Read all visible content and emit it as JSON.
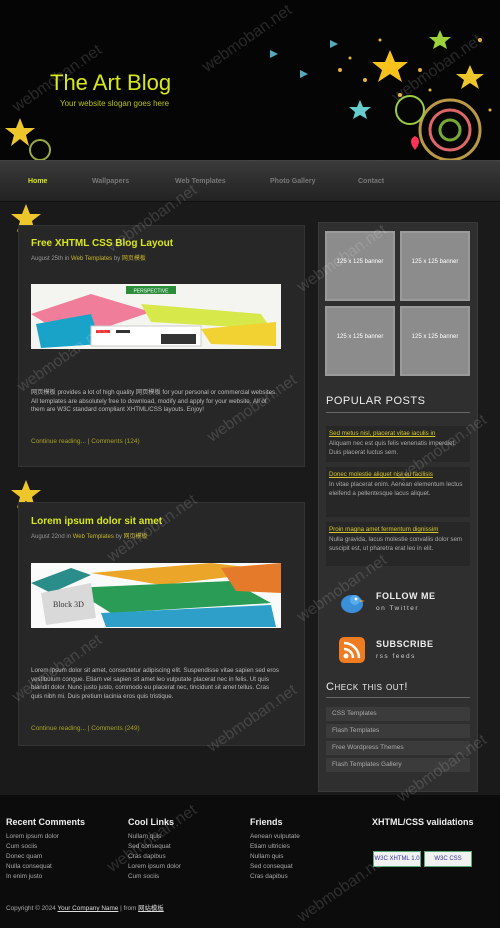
{
  "header": {
    "title": "The Art Blog",
    "slogan": "Your website slogan goes here"
  },
  "nav": {
    "items": [
      "Home",
      "Wallpapers",
      "Web Templates",
      "Photo Gallery",
      "Contact"
    ],
    "active": "Home"
  },
  "posts": [
    {
      "title": "Free XHTML CSS Blog Layout",
      "meta_date": "August 25th in",
      "meta_category": "Web Templates",
      "meta_by": "by",
      "meta_author": "网页模板",
      "image_label": "PERSPECTIVE",
      "body": "网页模板 provides a lot of high quality 网页模板 for your personal or commercial websites. All templates are absolutely free to download, modify and apply for your website. All of them are W3C standard compliant XHTML/CSS layouts. Enjoy!",
      "continue": "Continue reading...",
      "sep": "|",
      "comments": "Comments (124)"
    },
    {
      "title": "Lorem ipsum dolor sit amet",
      "meta_date": "August 22nd in",
      "meta_category": "Web Templates",
      "meta_by": "by",
      "meta_author": "网页模板",
      "image_label": "Block 3D",
      "body": "Lorem ipsum dolor sit amet, consectetur adipiscing elit. Suspendisse vitae sapien sed eros vestibulum congue. Etiam vel sapien sit amet leo vulputate placerat nec in felis. Ut quis blandit dolor. Nunc justo justo, commodo eu placerat nec, tincidunt sit amet tellus. Cras quis nibh mi. Duis pretium lacinia eros quis tristique.",
      "continue": "Continue reading...",
      "sep": "|",
      "comments": "Comments (249)"
    }
  ],
  "sidebar": {
    "banners": [
      "125 x 125 banner",
      "125 x 125 banner",
      "125 x 125 banner",
      "125 x 125 banner"
    ],
    "popular_heading": "POPULAR POSTS",
    "popular": [
      {
        "title": "Sed metus nisl, placerat vitae iaculis in",
        "text": "Aliquam nec est quis felis venenatis imperdiet. Duis placerat luctus sem."
      },
      {
        "title": "Donec molestie aliquet nisi eu facilisis",
        "text": "In vitae placerat enim. Aenean elementum lectus eleifend a pellentesque lacus aliquet."
      },
      {
        "title": "Proin magna amet fermentum dignissim",
        "text": "Nulla gravida, lacus molestie convallis dolor sem suscipit est, ut pharetra erat leo in elit."
      }
    ],
    "follow_big": "FOLLOW ME",
    "follow_small": "on Twitter",
    "subscribe_big": "SUBSCRIBE",
    "subscribe_small": "rss feeds",
    "check_heading": "Check this out!",
    "check_items": [
      "CSS Templates",
      "Flash Templates",
      "Free Wordpress Themes",
      "Flash Templates Gallery"
    ]
  },
  "footer": {
    "recent_heading": "Recent Comments",
    "recent": [
      "Lorem ipsum dolor",
      "Cum sociis",
      "Donec quam",
      "Nulla consequat",
      "In enim justo"
    ],
    "cool_heading": "Cool Links",
    "cool": [
      "Nullam quis",
      "Sed consequat",
      "Cras dapibus",
      "Lorem ipsum dolor",
      "Cum sociis"
    ],
    "friends_heading": "Friends",
    "friends": [
      "Aenean vulputate",
      "Etiam ultricies",
      "Nullam quis",
      "Sed consequat",
      "Cras dapibus"
    ],
    "valid_heading": "XHTML/CSS validations",
    "badge_xhtml": "W3C XHTML 1.0",
    "badge_css": "W3C CSS",
    "copyright_pre": "Copyright © 2024",
    "company": "Your Company Name",
    "from": "| from",
    "from_site": "网站模板"
  },
  "watermark": "webmoban.net",
  "colors": {
    "accent": "#d8e81a",
    "link": "#c9b52a",
    "bg": "#1a1a1a"
  }
}
